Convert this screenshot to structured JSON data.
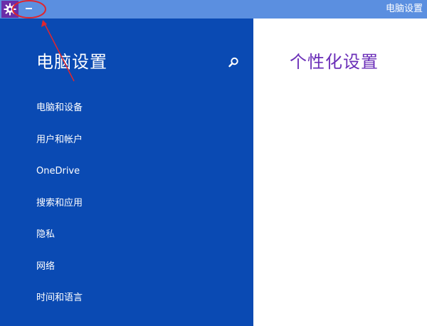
{
  "window": {
    "title": "电脑设置",
    "minimize_glyph": "—",
    "icon": "gear-icon"
  },
  "sidebar": {
    "title": "电脑设置",
    "search_icon": "search-icon",
    "items": [
      {
        "label": "电脑和设备"
      },
      {
        "label": "用户和帐户"
      },
      {
        "label": "OneDrive"
      },
      {
        "label": "搜索和应用"
      },
      {
        "label": "隐私"
      },
      {
        "label": "网络"
      },
      {
        "label": "时间和语言"
      }
    ]
  },
  "main": {
    "title": "个性化设置"
  },
  "colors": {
    "titlebar": "#5b8fe0",
    "sidebar": "#0a4ab3",
    "accent_purple": "#6b2fb8",
    "annotation_red": "#e0262e"
  }
}
